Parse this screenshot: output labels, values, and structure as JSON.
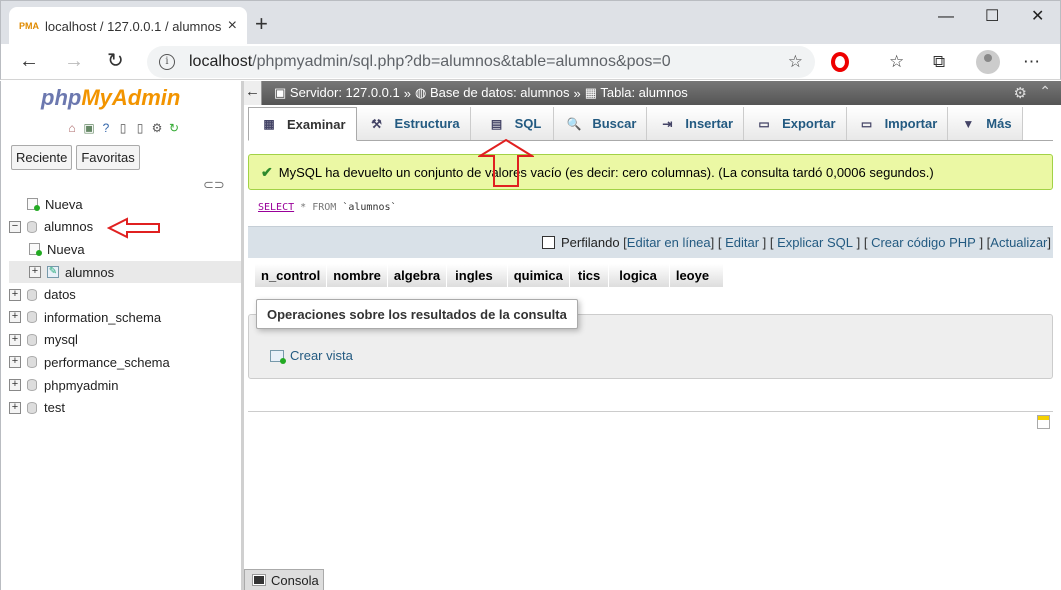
{
  "browser": {
    "tab_title": "localhost / 127.0.0.1 / alumnos /",
    "tab_close": "×",
    "new_tab": "+",
    "win_min": "—",
    "win_max": "☐",
    "win_close": "✕",
    "back": "←",
    "forward": "→",
    "reload": "↻",
    "url_host": "localhost",
    "url_path": "/phpmyadmin/sql.php?db=alumnos&table=alumnos&pos=0",
    "star": "☆",
    "favorites": "☆",
    "collections": "⧉",
    "menu": "⋯",
    "favicon_text": "PMA"
  },
  "nav": {
    "logo_php": "php",
    "logo_myadmin": "MyAdmin",
    "tab_recent": "Reciente",
    "tab_favorites": "Favoritas",
    "tree": [
      {
        "label": "Nueva",
        "kind": "new",
        "level": 0
      },
      {
        "label": "alumnos",
        "kind": "db",
        "level": 0,
        "expander": "−"
      },
      {
        "label": "Nueva",
        "kind": "new",
        "level": 1
      },
      {
        "label": "alumnos",
        "kind": "table",
        "level": 1,
        "expander": "+"
      },
      {
        "label": "datos",
        "kind": "db",
        "level": 0,
        "expander": "+"
      },
      {
        "label": "information_schema",
        "kind": "db",
        "level": 0,
        "expander": "+"
      },
      {
        "label": "mysql",
        "kind": "db",
        "level": 0,
        "expander": "+"
      },
      {
        "label": "performance_schema",
        "kind": "db",
        "level": 0,
        "expander": "+"
      },
      {
        "label": "phpmyadmin",
        "kind": "db",
        "level": 0,
        "expander": "+"
      },
      {
        "label": "test",
        "kind": "db",
        "level": 0,
        "expander": "+"
      }
    ]
  },
  "breadcrumb": {
    "collapse": "←",
    "server": "Servidor: 127.0.0.1",
    "sep1": "»",
    "database": "Base de datos: alumnos",
    "sep2": "»",
    "table": "Tabla: alumnos"
  },
  "tabs": [
    {
      "label": "Examinar",
      "icon": "▦",
      "active": true
    },
    {
      "label": "Estructura",
      "icon": "⚒",
      "active": false
    },
    {
      "label": "SQL",
      "icon": "▤",
      "active": false
    },
    {
      "label": "Buscar",
      "icon": "🔍",
      "active": false
    },
    {
      "label": "Insertar",
      "icon": "⇥",
      "active": false
    },
    {
      "label": "Exportar",
      "icon": "▭",
      "active": false
    },
    {
      "label": "Importar",
      "icon": "▭",
      "active": false
    },
    {
      "label": "Más",
      "icon": "▼",
      "active": false
    }
  ],
  "message": {
    "check": "✔",
    "text": "MySQL ha devuelto un conjunto de valores vacío (es decir: cero columnas). (La consulta tardó 0,0006 segundos.)"
  },
  "query": {
    "select": "SELECT",
    "star": "*",
    "from": "FROM",
    "table": "`alumnos`"
  },
  "tools": {
    "profiling": "Perfilando",
    "edit_inline": "Editar en línea",
    "edit": "Editar",
    "explain": "Explicar SQL",
    "create_php": "Crear código PHP",
    "refresh": "Actualizar"
  },
  "columns": [
    "n_control",
    "nombre",
    "algebra",
    "ingles",
    "quimica",
    "tics",
    "logica",
    "leoye"
  ],
  "operations": {
    "legend": "Operaciones sobre los resultados de la consulta",
    "create_view": "Crear vista"
  },
  "console": {
    "label": "Consola"
  },
  "colors": {
    "accent_orange": "#f29400",
    "accent_purple": "#6c78af",
    "link": "#235a81",
    "success_bg": "#ebf8a4",
    "annotation_red": "#e02020"
  }
}
